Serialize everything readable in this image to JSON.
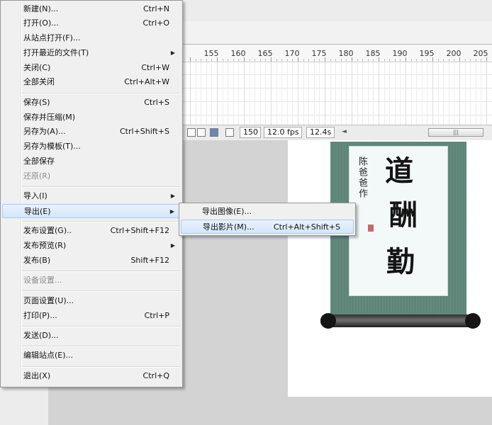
{
  "timeline": {
    "frame_numbers": [
      "155",
      "160",
      "165",
      "170",
      "175",
      "180",
      "185",
      "190",
      "195",
      "200",
      "205"
    ],
    "current_frame": "150",
    "frame_rate": "12.0 fps",
    "elapsed_time": "12.4s",
    "scroll_arrow": "◄",
    "scroll_grip": "|||"
  },
  "menu": {
    "items": [
      {
        "label": "新建(N)...",
        "shortcut": "Ctrl+N"
      },
      {
        "label": "打开(O)...",
        "shortcut": "Ctrl+O"
      },
      {
        "label": "从站点打开(F)...",
        "shortcut": ""
      },
      {
        "label": "打开最近的文件(T)",
        "shortcut": "",
        "submenu": true
      },
      {
        "label": "关闭(C)",
        "shortcut": "Ctrl+W"
      },
      {
        "label": "全部关闭",
        "shortcut": "Ctrl+Alt+W"
      },
      {
        "label": "保存(S)",
        "shortcut": "Ctrl+S"
      },
      {
        "label": "保存并压缩(M)",
        "shortcut": ""
      },
      {
        "label": "另存为(A)...",
        "shortcut": "Ctrl+Shift+S"
      },
      {
        "label": "另存为模板(T)...",
        "shortcut": ""
      },
      {
        "label": "全部保存",
        "shortcut": ""
      },
      {
        "label": "还原(R)",
        "shortcut": "",
        "disabled": true
      },
      {
        "label": "导入(I)",
        "shortcut": "",
        "submenu": true
      },
      {
        "label": "导出(E)",
        "shortcut": "",
        "submenu": true,
        "highlighted": true
      },
      {
        "label": "发布设置(G)..",
        "shortcut": "Ctrl+Shift+F12"
      },
      {
        "label": "发布预览(R)",
        "shortcut": "",
        "submenu": true
      },
      {
        "label": "发布(B)",
        "shortcut": "Shift+F12"
      },
      {
        "label": "设备设置...",
        "shortcut": "",
        "disabled": true
      },
      {
        "label": "页面设置(U)...",
        "shortcut": ""
      },
      {
        "label": "打印(P)...",
        "shortcut": "Ctrl+P"
      },
      {
        "label": "发送(D)...",
        "shortcut": ""
      },
      {
        "label": "编辑站点(E)...",
        "shortcut": ""
      },
      {
        "label": "退出(X)",
        "shortcut": "Ctrl+Q"
      }
    ],
    "submenu_arrow": "▶"
  },
  "export_submenu": {
    "items": [
      {
        "label": "导出图像(E)...",
        "shortcut": ""
      },
      {
        "label": "导出影片(M)...",
        "shortcut": "Ctrl+Alt+Shift+S",
        "highlighted": true
      }
    ]
  },
  "artwork": {
    "characters": [
      "道",
      "酬",
      "勤"
    ],
    "signature": "陈爸爸作",
    "colors": {
      "mount": "#5e8477",
      "paper": "#f3f9f9",
      "ink": "#141414"
    }
  }
}
